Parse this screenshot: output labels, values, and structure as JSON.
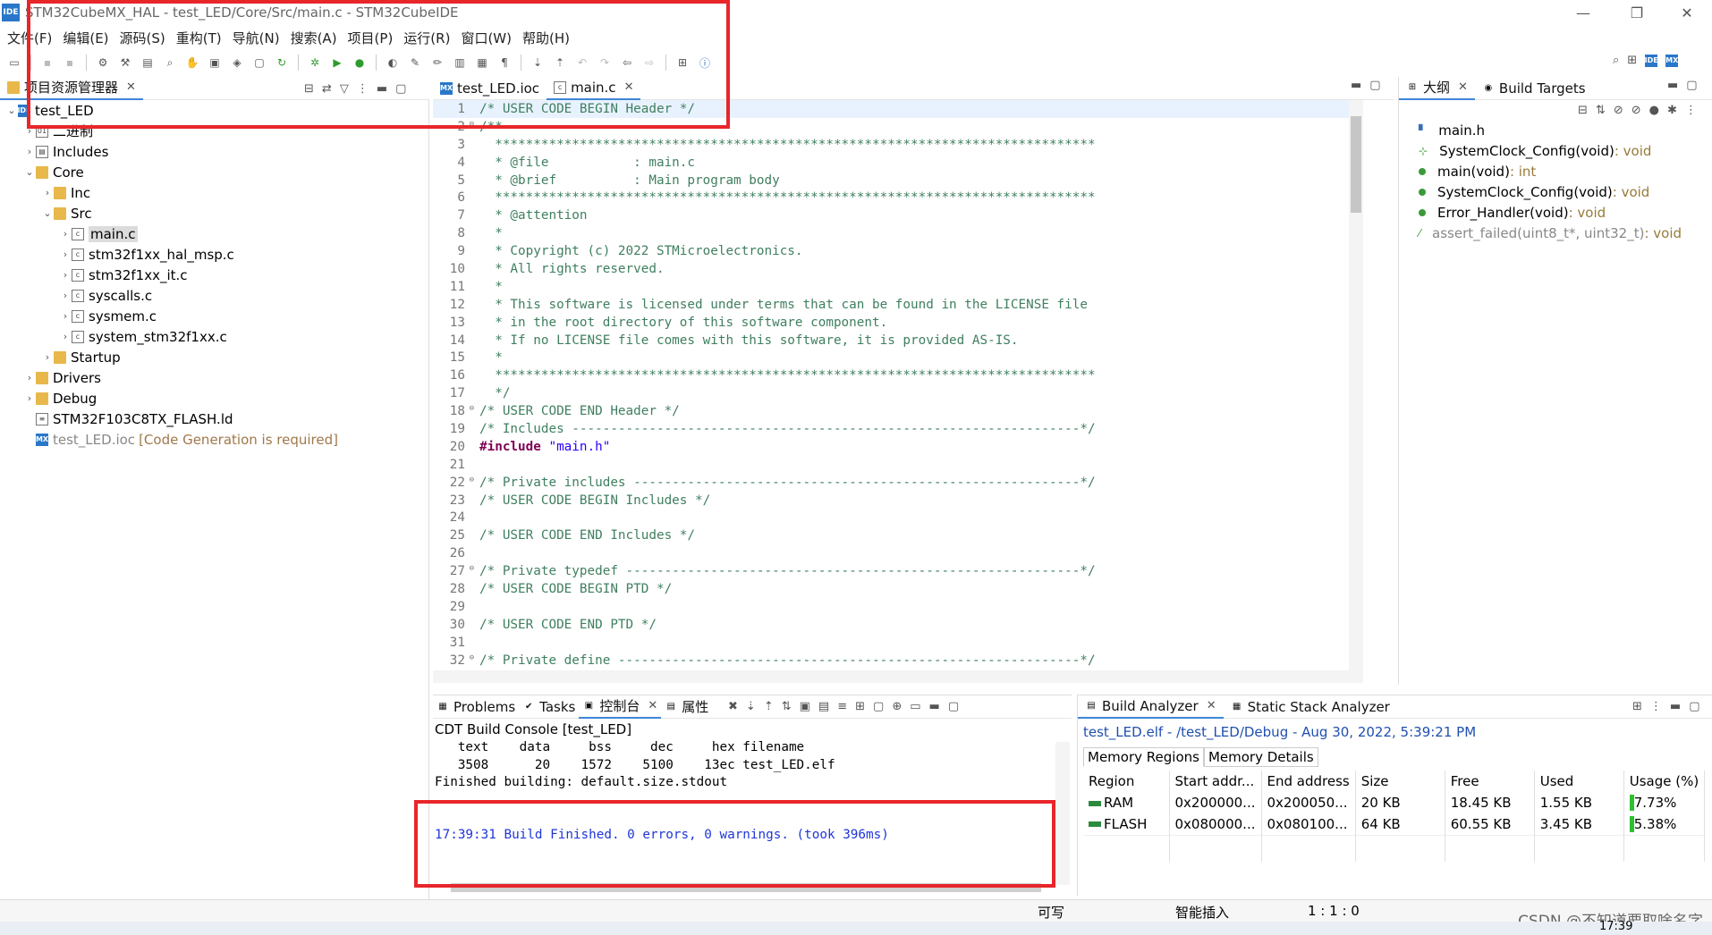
{
  "window": {
    "app_badge": "IDE",
    "title": "STM32CubeMX_HAL - test_LED/Core/Src/main.c - STM32CubeIDE",
    "minimize": "—",
    "maximize": "❐",
    "close": "✕"
  },
  "menu": [
    "文件(F)",
    "编辑(E)",
    "源码(S)",
    "重构(T)",
    "导航(N)",
    "搜索(A)",
    "项目(P)",
    "运行(R)",
    "窗口(W)",
    "帮助(H)"
  ],
  "project_explorer": {
    "tab_label": "项目资源管理器",
    "tree": [
      {
        "label": "test_LED",
        "arrow": "⌄",
        "icon": "project-icon",
        "indent": 0
      },
      {
        "label": "二进制",
        "arrow": "›",
        "icon": "binaries-icon",
        "indent": 1
      },
      {
        "label": "Includes",
        "arrow": "›",
        "icon": "includes-icon",
        "indent": 1
      },
      {
        "label": "Core",
        "arrow": "⌄",
        "icon": "folder-icon",
        "indent": 1
      },
      {
        "label": "Inc",
        "arrow": "›",
        "icon": "folder-icon",
        "indent": 2
      },
      {
        "label": "Src",
        "arrow": "⌄",
        "icon": "folder-icon",
        "indent": 2
      },
      {
        "label": "main.c",
        "arrow": "›",
        "icon": "c-file-icon",
        "indent": 3,
        "selected": true
      },
      {
        "label": "stm32f1xx_hal_msp.c",
        "arrow": "›",
        "icon": "c-file-icon",
        "indent": 3
      },
      {
        "label": "stm32f1xx_it.c",
        "arrow": "›",
        "icon": "c-file-icon",
        "indent": 3
      },
      {
        "label": "syscalls.c",
        "arrow": "›",
        "icon": "c-file-icon",
        "indent": 3
      },
      {
        "label": "sysmem.c",
        "arrow": "›",
        "icon": "c-file-icon",
        "indent": 3
      },
      {
        "label": "system_stm32f1xx.c",
        "arrow": "›",
        "icon": "c-file-icon",
        "indent": 3
      },
      {
        "label": "Startup",
        "arrow": "›",
        "icon": "folder-icon",
        "indent": 2
      },
      {
        "label": "Drivers",
        "arrow": "›",
        "icon": "folder-icon",
        "indent": 1
      },
      {
        "label": "Debug",
        "arrow": "›",
        "icon": "folder-icon",
        "indent": 1
      },
      {
        "label": "STM32F103C8TX_FLASH.ld",
        "arrow": "",
        "icon": "ld-file-icon",
        "indent": 1
      },
      {
        "label": "test_LED.ioc",
        "warn": "[Code Generation is required]",
        "arrow": "",
        "icon": "mx-file-icon",
        "indent": 1
      }
    ]
  },
  "editor": {
    "tabs": [
      {
        "label": "test_LED.ioc",
        "icon": "mx-file-icon"
      },
      {
        "label": "main.c",
        "icon": "c-file-icon",
        "active": true
      }
    ],
    "lines": [
      {
        "n": "1",
        "t": "/* USER CODE BEGIN Header */",
        "c": "cm"
      },
      {
        "n": "2",
        "t": "/**",
        "c": "cm",
        "fold": true
      },
      {
        "n": "3",
        "t": "  ******************************************************************************",
        "c": "cm"
      },
      {
        "n": "4",
        "t": "  * @file           : main.c",
        "c": "cm"
      },
      {
        "n": "5",
        "t": "  * @brief          : Main program body",
        "c": "cm"
      },
      {
        "n": "6",
        "t": "  ******************************************************************************",
        "c": "cm"
      },
      {
        "n": "7",
        "t": "  * @attention",
        "c": "cm"
      },
      {
        "n": "8",
        "t": "  *",
        "c": "cm"
      },
      {
        "n": "9",
        "t": "  * Copyright (c) 2022 STMicroelectronics.",
        "c": "cm"
      },
      {
        "n": "10",
        "t": "  * All rights reserved.",
        "c": "cm"
      },
      {
        "n": "11",
        "t": "  *",
        "c": "cm"
      },
      {
        "n": "12",
        "t": "  * This software is licensed under terms that can be found in the LICENSE file",
        "c": "cm"
      },
      {
        "n": "13",
        "t": "  * in the root directory of this software component.",
        "c": "cm"
      },
      {
        "n": "14",
        "t": "  * If no LICENSE file comes with this software, it is provided AS-IS.",
        "c": "cm"
      },
      {
        "n": "15",
        "t": "  *",
        "c": "cm"
      },
      {
        "n": "16",
        "t": "  ******************************************************************************",
        "c": "cm"
      },
      {
        "n": "17",
        "t": "  */",
        "c": "cm"
      },
      {
        "n": "18",
        "t": "/* USER CODE END Header */",
        "c": "cm",
        "fold": true
      },
      {
        "n": "19",
        "t": "/* Includes ------------------------------------------------------------------*/",
        "c": "cm"
      },
      {
        "n": "20",
        "t": "#include \"main.h\"",
        "c": "inc"
      },
      {
        "n": "21",
        "t": "",
        "c": ""
      },
      {
        "n": "22",
        "t": "/* Private includes ----------------------------------------------------------*/",
        "c": "cm",
        "fold": true
      },
      {
        "n": "23",
        "t": "/* USER CODE BEGIN Includes */",
        "c": "cm"
      },
      {
        "n": "24",
        "t": "",
        "c": ""
      },
      {
        "n": "25",
        "t": "/* USER CODE END Includes */",
        "c": "cm"
      },
      {
        "n": "26",
        "t": "",
        "c": ""
      },
      {
        "n": "27",
        "t": "/* Private typedef -----------------------------------------------------------*/",
        "c": "cm",
        "fold": true
      },
      {
        "n": "28",
        "t": "/* USER CODE BEGIN PTD */",
        "c": "cm"
      },
      {
        "n": "29",
        "t": "",
        "c": ""
      },
      {
        "n": "30",
        "t": "/* USER CODE END PTD */",
        "c": "cm"
      },
      {
        "n": "31",
        "t": "",
        "c": ""
      },
      {
        "n": "32",
        "t": "/* Private define ------------------------------------------------------------*/",
        "c": "cm",
        "fold": true
      }
    ]
  },
  "outline": {
    "tabs": [
      {
        "label": "大纲",
        "active": true
      },
      {
        "label": "Build Targets"
      }
    ],
    "items": [
      {
        "name": "main.h",
        "ret": "",
        "icon": "header-include-icon"
      },
      {
        "name": "SystemClock_Config(void)",
        "ret": " : void",
        "icon": "declaration-icon"
      },
      {
        "name": "main(void)",
        "ret": " : int",
        "icon": "function-icon"
      },
      {
        "name": "SystemClock_Config(void)",
        "ret": " : void",
        "icon": "function-icon"
      },
      {
        "name": "Error_Handler(void)",
        "ret": " : void",
        "icon": "function-icon"
      },
      {
        "name": "assert_failed(uint8_t*, uint32_t)",
        "ret": " : void",
        "icon": "disabled-function-icon",
        "grey": true
      }
    ]
  },
  "console_panel": {
    "tabs": [
      {
        "label": "Problems"
      },
      {
        "label": "Tasks"
      },
      {
        "label": "控制台",
        "active": true
      },
      {
        "label": "属性"
      }
    ],
    "header": "CDT Build Console [test_LED]",
    "lines": [
      {
        "t": "   text    data     bss     dec     hex filename",
        "blue": false
      },
      {
        "t": "   3508      20    1572    5100    13ec test_LED.elf",
        "blue": false
      },
      {
        "t": "Finished building: default.size.stdout",
        "blue": false
      },
      {
        "t": " ",
        "blue": false
      },
      {
        "t": " ",
        "blue": false
      },
      {
        "t": "17:39:31 Build Finished. 0 errors, 0 warnings. (took 396ms)",
        "blue": true
      }
    ]
  },
  "build_analyzer": {
    "tabs": [
      {
        "label": "Build Analyzer",
        "active": true
      },
      {
        "label": "Static Stack Analyzer"
      }
    ],
    "title": "test_LED.elf - /test_LED/Debug - Aug 30, 2022, 5:39:21 PM",
    "subtabs": [
      "Memory Regions",
      "Memory Details"
    ],
    "columns": [
      "Region",
      "Start addr...",
      "End address",
      "Size",
      "Free",
      "Used",
      "Usage (%)"
    ],
    "rows": [
      {
        "region": "RAM",
        "start": "0x200000...",
        "end": "0x200050...",
        "size": "20 KB",
        "free": "18.45 KB",
        "used": "1.55 KB",
        "usage": "7.73%"
      },
      {
        "region": "FLASH",
        "start": "0x080000...",
        "end": "0x080100...",
        "size": "64 KB",
        "free": "60.55 KB",
        "used": "3.45 KB",
        "usage": "5.38%"
      }
    ]
  },
  "status_bar": {
    "writable": "可写",
    "insert_mode": "智能插入",
    "position": "1 : 1 : 0"
  },
  "watermark": "CSDN @不知道要取啥名字",
  "taskbar_time": "17:39",
  "colors": {
    "highlight_box": "#e8262a",
    "comment": "#3f7f5f",
    "keyword": "#7f0055",
    "string": "#2a00ff",
    "console_blue": "#1f35d8"
  }
}
